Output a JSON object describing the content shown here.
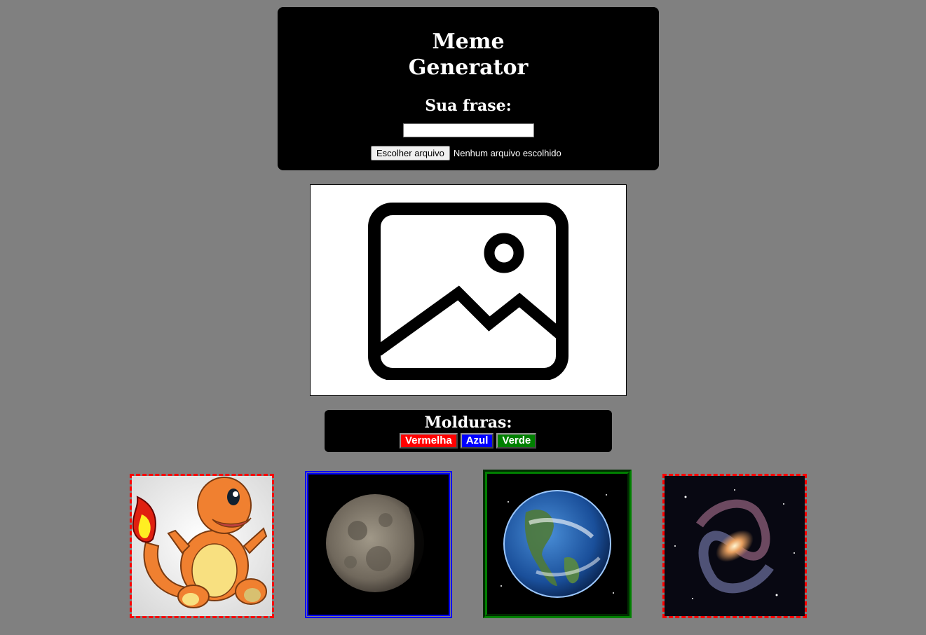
{
  "header": {
    "title_line1": "Meme",
    "title_line2": "Generator",
    "phrase_label": "Sua frase:",
    "phrase_input_value": "",
    "file_button_label": "Escolher arquivo",
    "file_status": "Nenhum arquivo escolhido"
  },
  "preview": {
    "icon": "image-placeholder-icon"
  },
  "frames": {
    "label": "Molduras:",
    "buttons": [
      {
        "label": "Vermelha",
        "color": "#ff0000"
      },
      {
        "label": "Azul",
        "color": "#0000ff"
      },
      {
        "label": "Verde",
        "color": "#008000"
      }
    ]
  },
  "thumbnails": [
    {
      "name": "charmander",
      "border": "dashed red"
    },
    {
      "name": "moon",
      "border": "double blue"
    },
    {
      "name": "earth",
      "border": "groove green"
    },
    {
      "name": "galaxy",
      "border": "dashed red"
    }
  ],
  "colors": {
    "background": "#808080",
    "panel": "#000000"
  }
}
